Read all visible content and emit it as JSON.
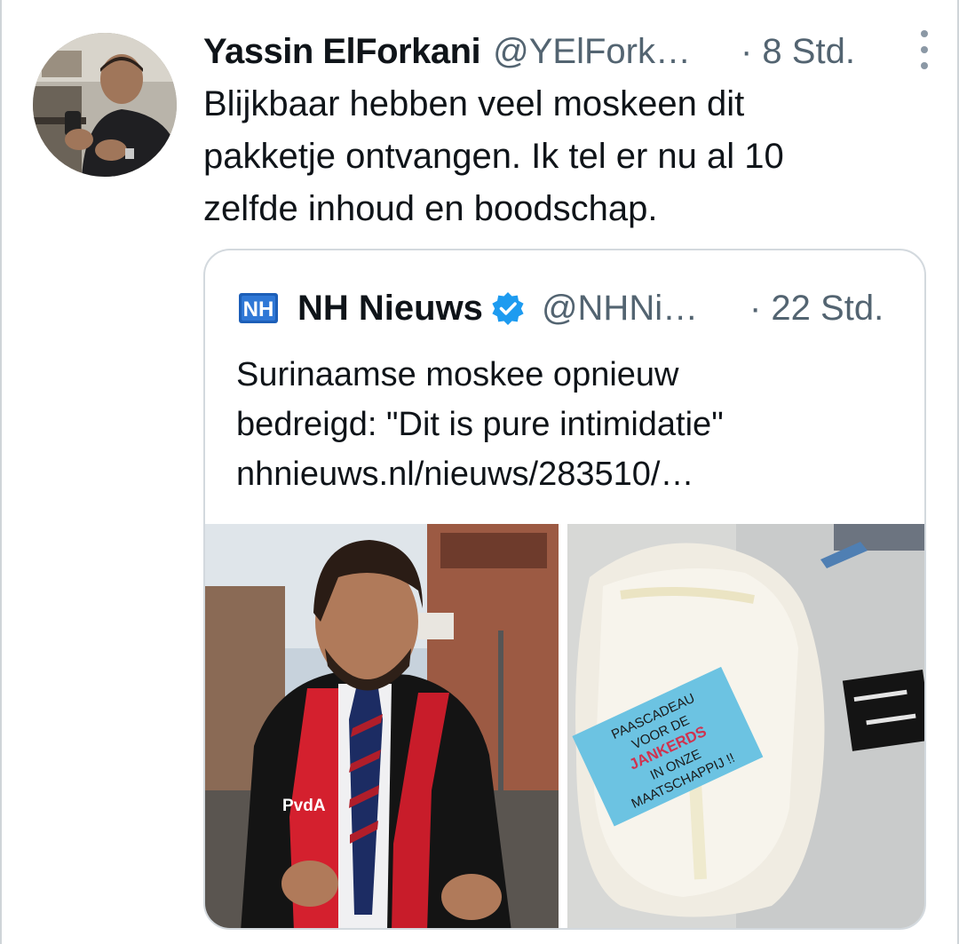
{
  "tweet": {
    "author_name": "Yassin ElForkani",
    "author_handle": "@YElFork…",
    "time": "· 8 Std.",
    "text_lines": [
      "Blijkbaar hebben veel moskeen dit",
      "pakketje ontvangen. Ik tel er nu al 10",
      "zelfde inhoud en boodschap."
    ]
  },
  "quote": {
    "logo_text": "NH",
    "author_name": "NH Nieuws",
    "author_handle": "@NHNi…",
    "time": "· 22 Std.",
    "text_lines": [
      "Surinaamse moskee opnieuw",
      "bedreigd: \"Dit is pure intimidatie\"",
      "nhnieuws.nl/nieuws/283510/…"
    ],
    "media": {
      "left_scarf_text": "PvdA",
      "right_sticker_lines": [
        "PAASCADEAU",
        "VOOR DE",
        "JANKERDS",
        "IN ONZE",
        "MAATSCHAPPIJ !!"
      ]
    }
  },
  "icons": {
    "more": "more-vertical-icon",
    "verified": "verified-badge-icon"
  },
  "colors": {
    "text": "#0f1419",
    "secondary": "#536471",
    "verified": "#1d9bf0",
    "border": "#d3d9de",
    "nh_logo": "#1d5fb8"
  }
}
